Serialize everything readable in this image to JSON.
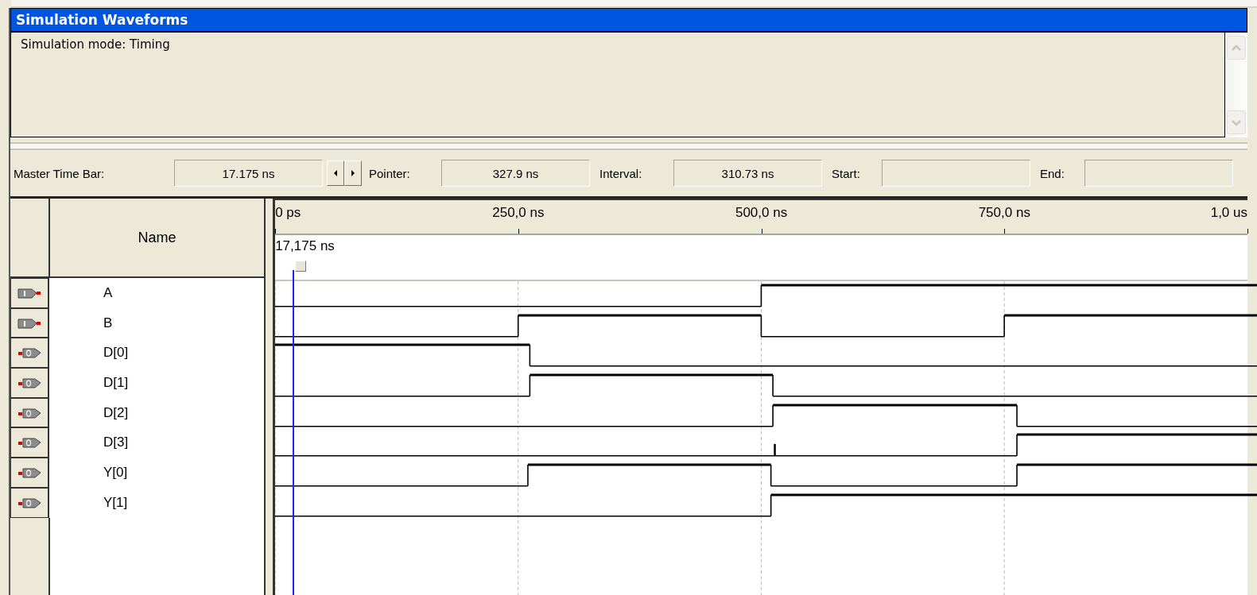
{
  "panel": {
    "title": "Simulation Waveforms",
    "message": "Simulation mode: Timing"
  },
  "time_bar": [
    {
      "label": "Master Time Bar:",
      "value": "17.175 ns",
      "kind": "stepper"
    },
    {
      "label": "Pointer:",
      "value": "327.9 ns",
      "kind": "plain"
    },
    {
      "label": "Interval:",
      "value": "310.73 ns",
      "kind": "plain"
    },
    {
      "label": "Start:",
      "kind": "plain"
    },
    {
      "label": "End:",
      "kind": "plain"
    }
  ],
  "name_header": "Name",
  "ruler": {
    "ticks": [
      "0 ps",
      "250,0 ns",
      "500,0 ns",
      "750,0 ns",
      "1,0 us"
    ],
    "cursor_label": "17,175 ns",
    "cursor": {
      "level": 0.017175
    }
  },
  "signals": [
    {
      "name": "A",
      "kind": "input"
    },
    {
      "name": "B",
      "kind": "input"
    },
    {
      "name": "D[0]",
      "kind": "output"
    },
    {
      "name": "D[1]",
      "kind": "output"
    },
    {
      "name": "D[2]",
      "kind": "output"
    },
    {
      "name": "D[3]",
      "kind": "output"
    },
    {
      "name": "Y[0]",
      "kind": "output"
    },
    {
      "name": "Y[1]",
      "kind": "output"
    }
  ]
}
